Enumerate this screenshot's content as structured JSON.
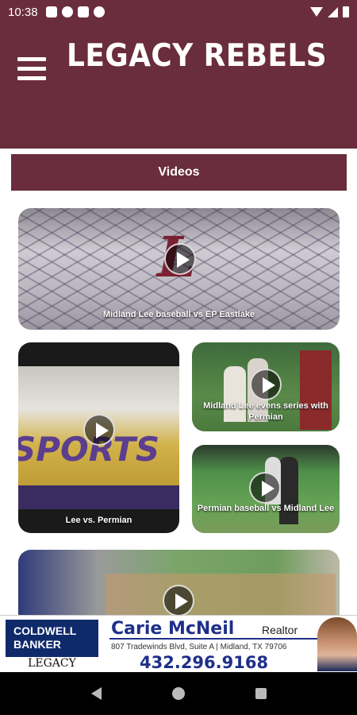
{
  "status_bar": {
    "time": "10:38",
    "icons": [
      "gear-icon",
      "a-icon",
      "sd-card-icon",
      "no-sync-icon"
    ],
    "right_icons": [
      "wifi-icon",
      "signal-icon",
      "battery-icon"
    ]
  },
  "header": {
    "title": "LEGACY REBELS",
    "menu_icon": "hamburger-menu-icon"
  },
  "section": {
    "label": "Videos"
  },
  "videos": [
    {
      "caption": "Midland Lee baseball vs EP Eastlake",
      "thumb_text": "L"
    },
    {
      "caption": "Lee vs. Permian",
      "thumb_text": "SPORTS"
    },
    {
      "caption": "Midland Lee evens series with Permian"
    },
    {
      "caption": "Permian baseball vs Midland Lee"
    },
    {
      "caption": ""
    }
  ],
  "ad": {
    "brand": "COLDWELL BANKER",
    "brand_sub": "LEGACY",
    "name": "Carie McNeil",
    "role": "Realtor",
    "address": "807 Tradewinds Blvd, Suite A | Midland, TX 79706",
    "phone": "432.296.9168"
  },
  "colors": {
    "primary": "#6a2d3d",
    "ad_blue": "#1e2f8a"
  }
}
